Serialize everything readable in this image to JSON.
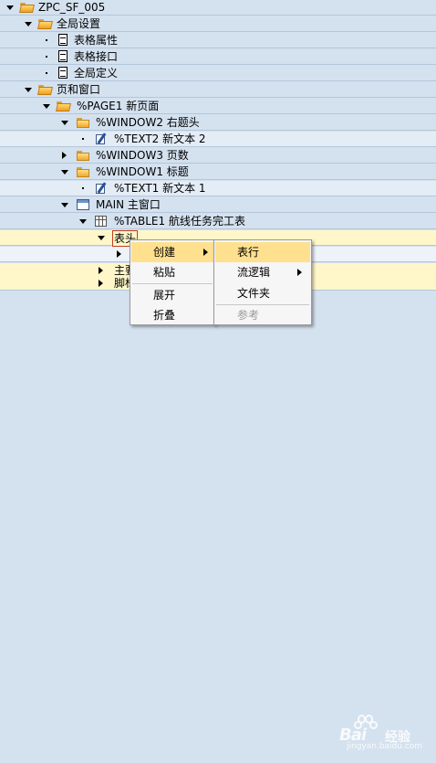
{
  "tree": {
    "root": "ZPC_SF_005",
    "global_settings": "全局设置",
    "form_attributes": "表格属性",
    "form_interface": "表格接口",
    "global_definitions": "全局定义",
    "pages_windows": "页和窗口",
    "page1": "%PAGE1 新页面",
    "window2": "%WINDOW2 右题头",
    "text2": "%TEXT2 新文本 2",
    "window3": "%WINDOW3 页数",
    "window1": "%WINDOW1 标题",
    "text1": "%TEXT1 新文本 1",
    "main": "MAIN 主窗口",
    "table1": "%TABLE1 航线任务完工表",
    "header_partial": "表头",
    "main_partial": "主要",
    "footer_partial": "脚标"
  },
  "context_menu": {
    "create": "创建",
    "paste": "粘贴",
    "expand": "展开",
    "collapse": "折叠"
  },
  "submenu": {
    "table_row": "表行",
    "flow_logic": "流逻辑",
    "folder": "文件夹",
    "reference": "参考"
  },
  "watermark": {
    "brand": "Bai",
    "brand_cn": "经验",
    "url": "jingyan.baidu.com"
  },
  "colors": {
    "background": "#d4e1ef",
    "highlight": "#fff7c9",
    "menu_active": "#ffe08e"
  }
}
